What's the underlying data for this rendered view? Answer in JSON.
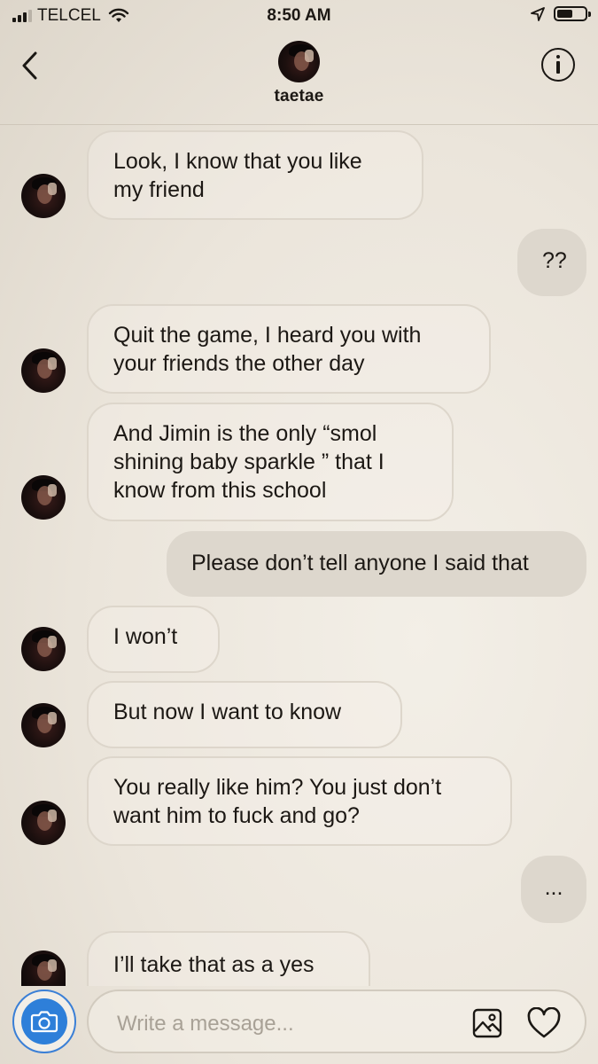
{
  "status_bar": {
    "carrier": "TELCEL",
    "time": "8:50 AM",
    "icons": [
      "signal-icon",
      "wifi-icon",
      "location-arrow-icon",
      "battery-icon"
    ],
    "battery_level": 0.55
  },
  "header": {
    "contact_name": "taetae",
    "back_icon": "chevron-left-icon",
    "info_icon": "info-icon"
  },
  "messages": [
    {
      "from": "them",
      "text": "Look, I know that you like\nmy friend"
    },
    {
      "from": "me",
      "text": "??"
    },
    {
      "from": "them",
      "text": "Quit the game, I heard you with\nyour friends the other day"
    },
    {
      "from": "them",
      "text": "And Jimin is the only “smol\nshining baby sparkle ” that I\nknow from this school"
    },
    {
      "from": "me",
      "text": "Please don’t tell anyone I said that"
    },
    {
      "from": "them",
      "text": "I won’t"
    },
    {
      "from": "them",
      "text": "But now I want to know"
    },
    {
      "from": "them",
      "text": "You really like him? You just don’t\nwant him to fuck and go?"
    },
    {
      "from": "me",
      "text": "..."
    },
    {
      "from": "them",
      "text": "I’ll take that as a yes"
    }
  ],
  "composer": {
    "placeholder": "Write a message...",
    "value": "",
    "icons": [
      "camera-icon",
      "gallery-icon",
      "heart-icon"
    ]
  },
  "colors": {
    "background": "#ebe5db",
    "outgoing_bubble": "#ddd7cd",
    "incoming_border": "#ddd6cb",
    "camera_accent": "#2e7fd9"
  }
}
